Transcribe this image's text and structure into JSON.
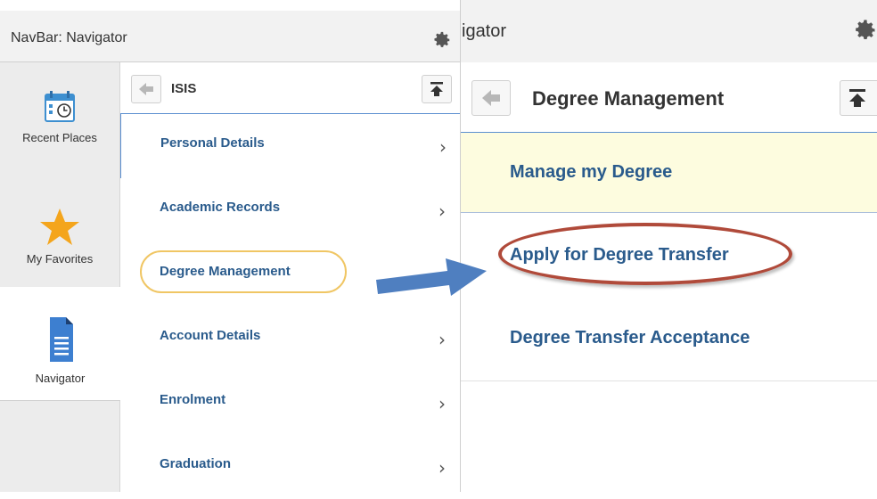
{
  "left": {
    "header_title": "NavBar: Navigator",
    "rail": {
      "recent_label": "Recent Places",
      "favorites_label": "My Favorites",
      "navigator_label": "Navigator"
    },
    "menu_title": "ISIS",
    "items": [
      {
        "label": "Personal Details"
      },
      {
        "label": "Academic Records"
      },
      {
        "label": "Degree Management"
      },
      {
        "label": "Account Details"
      },
      {
        "label": "Enrolment"
      },
      {
        "label": "Graduation"
      }
    ],
    "chevron": "›"
  },
  "right": {
    "header_title": "igator",
    "menu_title": "Degree Management",
    "items": [
      {
        "label": "Manage my Degree"
      },
      {
        "label": "Apply for Degree Transfer"
      },
      {
        "label": "Degree Transfer Acceptance"
      }
    ]
  },
  "colors": {
    "link": "#2a5b8c",
    "highlight_yellow": "#f0c664",
    "highlight_red": "#b04a3a",
    "arrow_blue": "#4f7fc0",
    "selected_bg": "#fdfcdf"
  }
}
